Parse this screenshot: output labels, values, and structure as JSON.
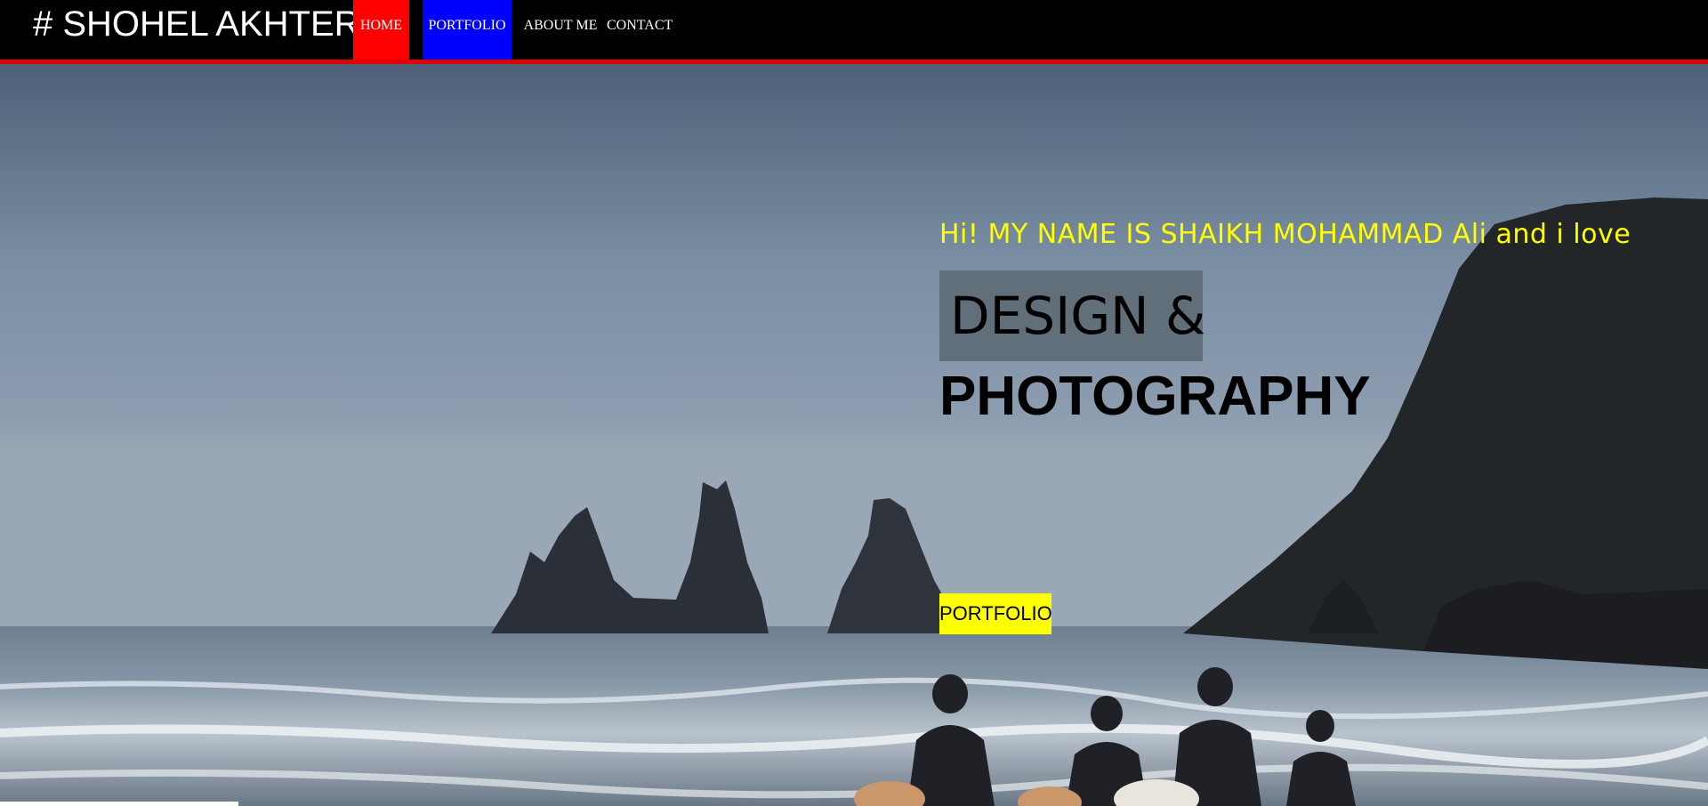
{
  "header": {
    "brand": "# SHOHEL AKHTER",
    "nav": [
      {
        "label": "HOME",
        "bg_color": "#ff0000"
      },
      {
        "label": "PORTFOLIO",
        "bg_color": "#0000ff"
      },
      {
        "label": "ABOUT ME"
      },
      {
        "label": "CONTACT"
      }
    ],
    "accent_border_color": "#e10000"
  },
  "hero": {
    "greeting": "Hi! MY NAME IS SHAIKH MOHAMMAD Ali and i love",
    "highlight_word": "DESIGN &",
    "second_word": "PHOTOGRAPHY",
    "button_label": "PORTFOLIO",
    "greeting_color": "#ffff00",
    "button_color": "#ffff00",
    "background_image": "beach-horse-riders-photo"
  }
}
